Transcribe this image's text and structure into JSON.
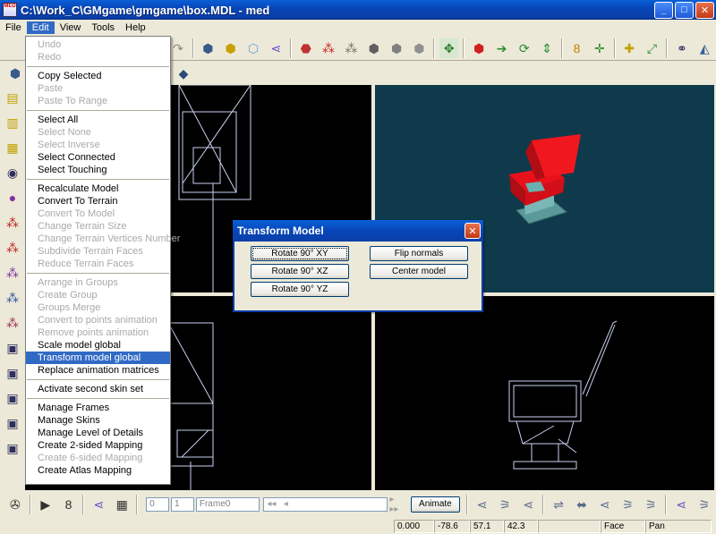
{
  "window": {
    "title": "C:\\Work_C\\GMgame\\gmgame\\box.MDL - med",
    "app_icon_text": "MED"
  },
  "menubar": [
    "File",
    "Edit",
    "View",
    "Tools",
    "Help"
  ],
  "edit_menu": {
    "groups": [
      [
        {
          "label": "Undo",
          "enabled": false
        },
        {
          "label": "Redo",
          "enabled": false
        }
      ],
      [
        {
          "label": "Copy Selected",
          "enabled": true
        },
        {
          "label": "Paste",
          "enabled": false
        },
        {
          "label": "Paste To Range",
          "enabled": false
        }
      ],
      [
        {
          "label": "Select All",
          "enabled": true
        },
        {
          "label": "Select None",
          "enabled": false
        },
        {
          "label": "Select Inverse",
          "enabled": false
        },
        {
          "label": "Select Connected",
          "enabled": true
        },
        {
          "label": "Select Touching",
          "enabled": true
        }
      ],
      [
        {
          "label": "Recalculate Model",
          "enabled": true
        },
        {
          "label": "Convert To Terrain",
          "enabled": true
        },
        {
          "label": "Convert To Model",
          "enabled": false
        },
        {
          "label": "Change Terrain Size",
          "enabled": false
        },
        {
          "label": "Change Terrain Vertices Number",
          "enabled": false
        },
        {
          "label": "Subdivide Terrain Faces",
          "enabled": false
        },
        {
          "label": "Reduce Terrain Faces",
          "enabled": false
        }
      ],
      [
        {
          "label": "Arrange in Groups",
          "enabled": false
        },
        {
          "label": "Create Group",
          "enabled": false
        },
        {
          "label": "Groups Merge",
          "enabled": false
        },
        {
          "label": "Convert to points animation",
          "enabled": false
        },
        {
          "label": "Remove points animation",
          "enabled": false
        },
        {
          "label": "Scale model global",
          "enabled": true
        },
        {
          "label": "Transform model global",
          "enabled": true,
          "highlighted": true
        },
        {
          "label": "Replace animation matrices",
          "enabled": true
        }
      ],
      [
        {
          "label": "Activate second skin set",
          "enabled": true
        }
      ],
      [
        {
          "label": "Manage Frames",
          "enabled": true
        },
        {
          "label": "Manage Skins",
          "enabled": true
        },
        {
          "label": "Manage Level of Details",
          "enabled": true
        },
        {
          "label": "Create 2-sided Mapping",
          "enabled": true
        },
        {
          "label": "Create 6-sided Mapping",
          "enabled": false
        },
        {
          "label": "Create Atlas Mapping",
          "enabled": true
        }
      ]
    ]
  },
  "dialog": {
    "title": "Transform Model",
    "close": "✕",
    "buttons": {
      "rotate_xy": "Rotate 90° XY",
      "rotate_xz": "Rotate 90° XZ",
      "rotate_yz": "Rotate 90° YZ",
      "flip_normals": "Flip normals",
      "center_model": "Center model"
    }
  },
  "timeline": {
    "frame_start": "0",
    "frame_count": "1",
    "frame_name": "Frame0",
    "animate_label": "Animate"
  },
  "status": {
    "fields": [
      "0.000",
      "-78.6",
      "57.1",
      "42.3",
      "",
      "Face",
      "Pan"
    ]
  },
  "colors": {
    "titlebar": "#0a3fa8",
    "highlight": "#316ac5",
    "viewport_bg": "#000000",
    "viewport_3d_bg": "#0e3a4c",
    "model_red": "#e8111b",
    "wire": "#c8d0f0"
  }
}
